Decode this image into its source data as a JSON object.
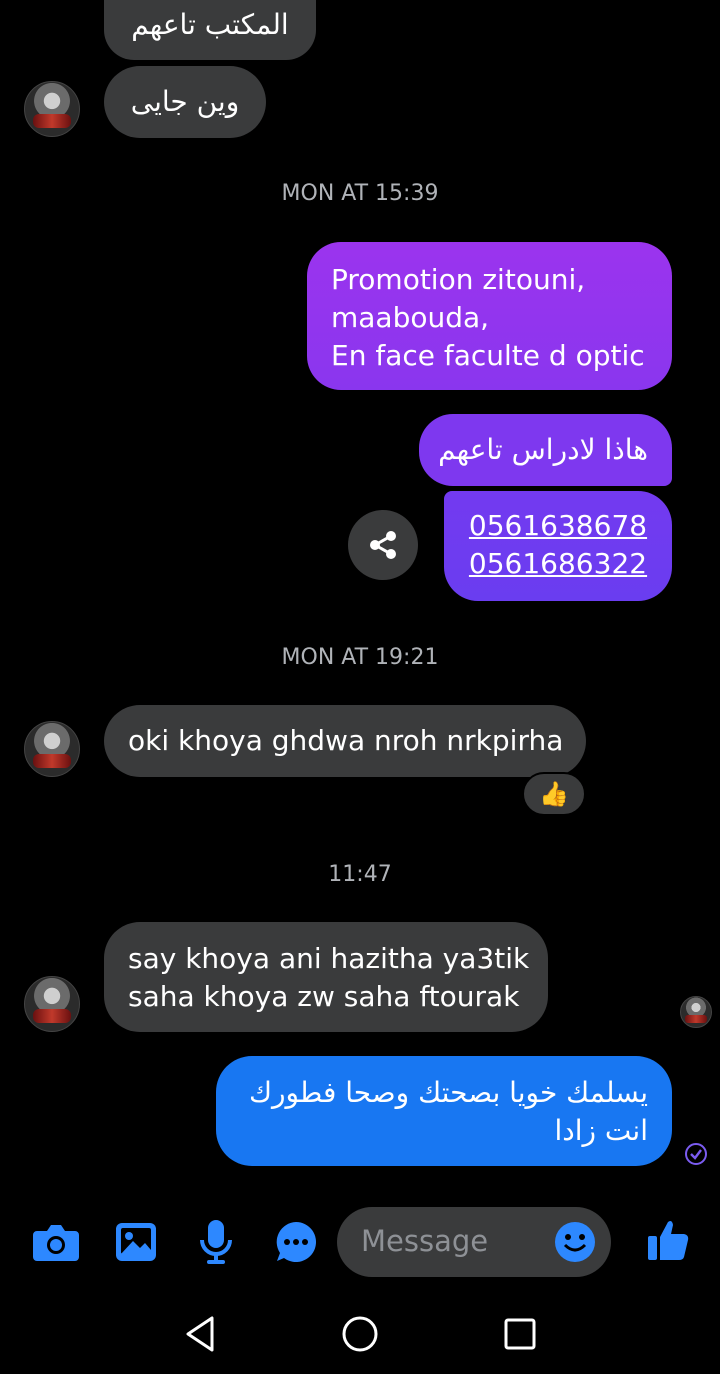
{
  "colors": {
    "background": "#000000",
    "incoming": "#3a3b3c",
    "purple_top": "#9b34ee",
    "purple_bottom": "#6a3df0",
    "blue": "#1877f2",
    "icon": "#2d88ff"
  },
  "messages": {
    "incoming_partial": "المكتب تاعهم",
    "incoming_1": "وين جايى",
    "outgoing_1": [
      "Promotion zitouni,",
      "maabouda,",
      "En face faculte d optic"
    ],
    "outgoing_2": "هاذا لادراس تاعهم",
    "phones": [
      "0561638678",
      "0561686322"
    ],
    "incoming_2": "oki khoya ghdwa nroh nrkpirha",
    "reaction": "👍",
    "incoming_3": [
      "say khoya ani hazitha ya3tik",
      "saha khoya zw saha ftourak"
    ],
    "outgoing_3": [
      "يسلمك خويا بصحتك وصحا فطورك",
      "انت زادا"
    ]
  },
  "timestamps": {
    "t1": "MON AT 15:39",
    "t2": "MON AT 19:21",
    "t3": "11:47"
  },
  "composer": {
    "placeholder": "Message"
  },
  "icons": {
    "share": "share-icon",
    "camera": "camera-icon",
    "gallery": "image-icon",
    "mic": "microphone-icon",
    "more": "chat-more-icon",
    "emoji": "emoji-icon",
    "like": "thumbs-up-icon",
    "seen": "check-circle-icon"
  }
}
